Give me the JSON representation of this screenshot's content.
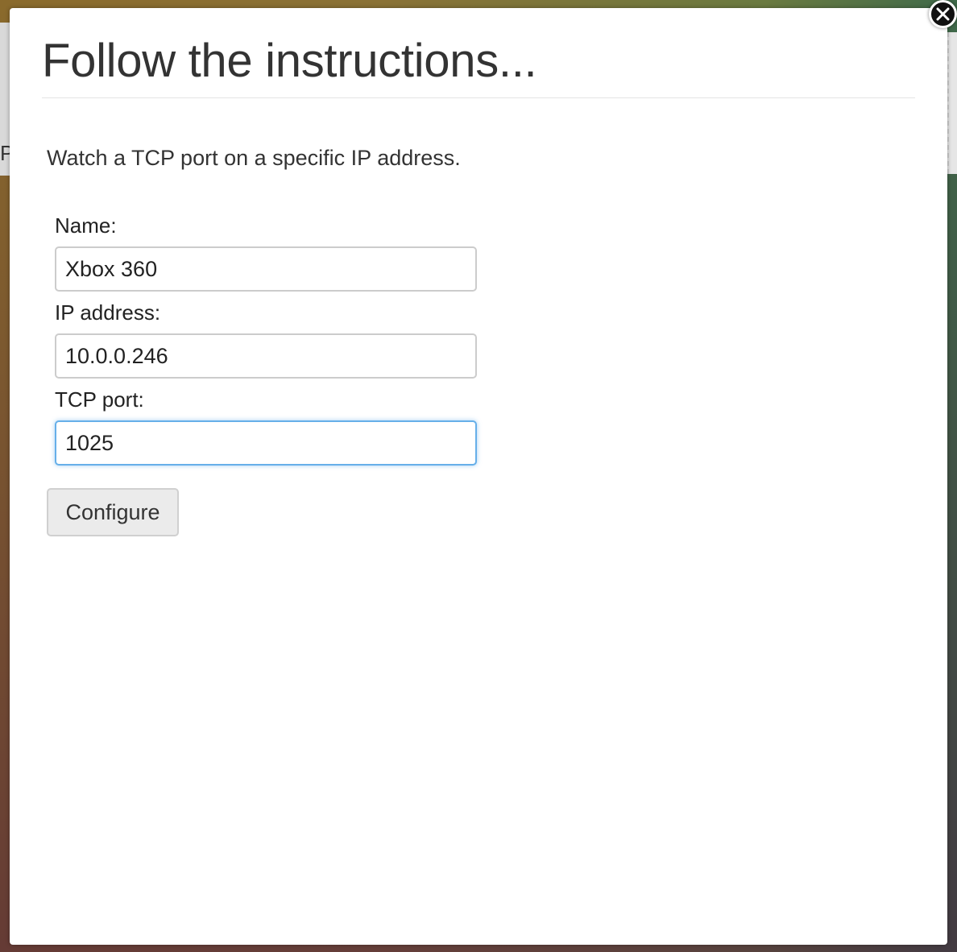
{
  "background": {
    "peek_letter": "P"
  },
  "modal": {
    "title": "Follow the instructions...",
    "instructions": "Watch a TCP port on a specific IP address.",
    "fields": {
      "name": {
        "label": "Name:",
        "value": "Xbox 360"
      },
      "ip": {
        "label": "IP address:",
        "value": "10.0.0.246"
      },
      "port": {
        "label": "TCP port:",
        "value": "1025"
      }
    },
    "configure_label": "Configure",
    "close_icon": "close-icon"
  },
  "colors": {
    "focus_border": "#66afe9",
    "modal_bg": "#ffffff",
    "button_bg": "#ebebeb",
    "close_bg": "#111111"
  }
}
